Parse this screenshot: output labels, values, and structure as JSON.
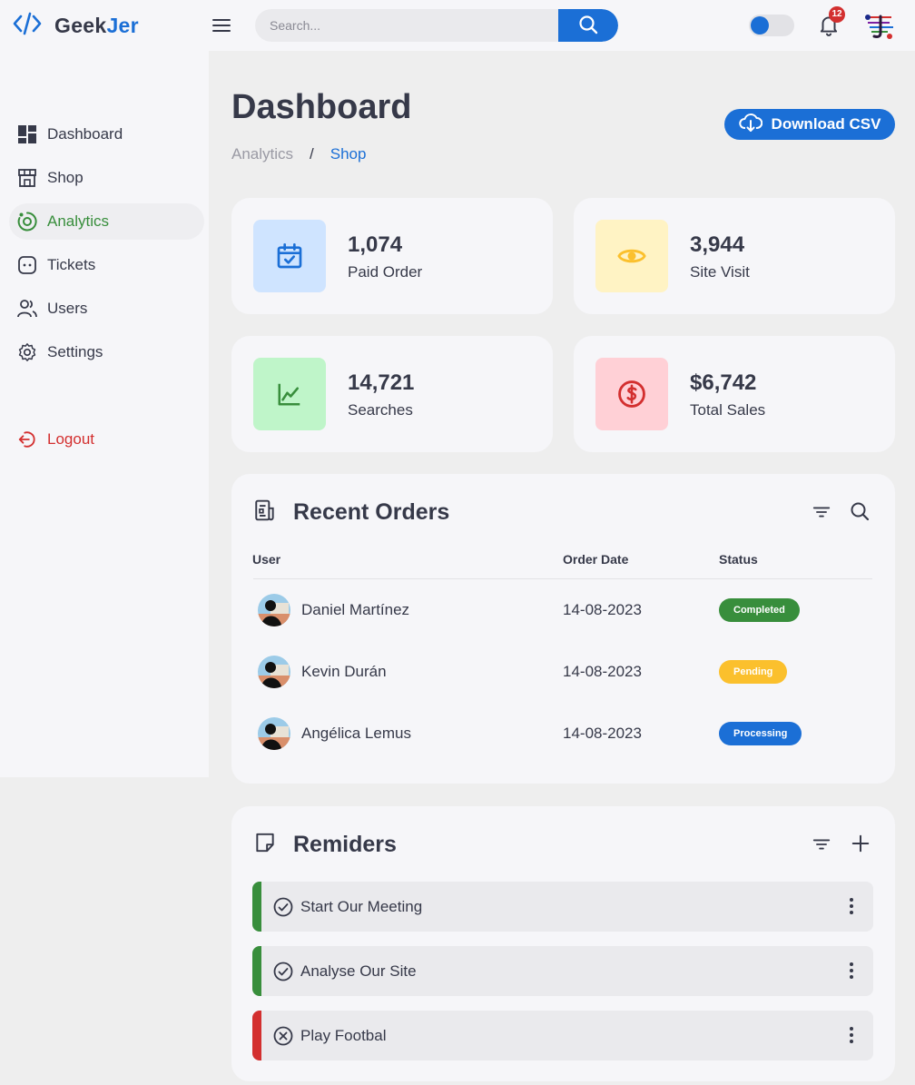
{
  "app": {
    "brand_part1": "Geek",
    "brand_part2": "Jer",
    "accent_color": "#1b6fd6"
  },
  "topbar": {
    "search_placeholder": "Search...",
    "notification_count": "12",
    "theme_toggle_state": "light"
  },
  "sidebar": {
    "items": [
      {
        "label": "Dashboard",
        "icon": "dashboard-icon"
      },
      {
        "label": "Shop",
        "icon": "store-icon"
      },
      {
        "label": "Analytics",
        "icon": "analytics-icon",
        "active": true
      },
      {
        "label": "Tickets",
        "icon": "ticket-icon"
      },
      {
        "label": "Users",
        "icon": "users-icon"
      },
      {
        "label": "Settings",
        "icon": "gear-icon"
      }
    ],
    "logout_label": "Logout"
  },
  "header": {
    "title": "Dashboard",
    "breadcrumb": [
      "Analytics",
      "Shop"
    ],
    "breadcrumb_separator": "/",
    "download_label": "Download CSV"
  },
  "stats": [
    {
      "value": "1,074",
      "label": "Paid Order",
      "icon": "calendar-check-icon",
      "color": "#1b6fd6",
      "bg": "#cfe4ff"
    },
    {
      "value": "3,944",
      "label": "Site Visit",
      "icon": "eye-icon",
      "color": "#fbc02d",
      "bg": "#fff3c4"
    },
    {
      "value": "14,721",
      "label": "Searches",
      "icon": "line-chart-icon",
      "color": "#388e3c",
      "bg": "#bff5c9"
    },
    {
      "value": "$6,742",
      "label": "Total Sales",
      "icon": "dollar-icon",
      "color": "#d32f2f",
      "bg": "#ffd0d6"
    }
  ],
  "orders": {
    "title": "Recent Orders",
    "columns": [
      "User",
      "Order Date",
      "Status"
    ],
    "rows": [
      {
        "user": "Daniel Martínez",
        "date": "14-08-2023",
        "status": "Completed",
        "status_kind": "completed"
      },
      {
        "user": "Kevin Durán",
        "date": "14-08-2023",
        "status": "Pending",
        "status_kind": "pending"
      },
      {
        "user": "Angélica Lemus",
        "date": "14-08-2023",
        "status": "Processing",
        "status_kind": "processing"
      }
    ]
  },
  "reminders": {
    "title": "Remiders",
    "items": [
      {
        "text": "Start Our Meeting",
        "done": true,
        "color": "#388e3c"
      },
      {
        "text": "Analyse Our Site",
        "done": true,
        "color": "#388e3c"
      },
      {
        "text": "Play Footbal",
        "done": false,
        "color": "#d32f2f"
      }
    ]
  }
}
